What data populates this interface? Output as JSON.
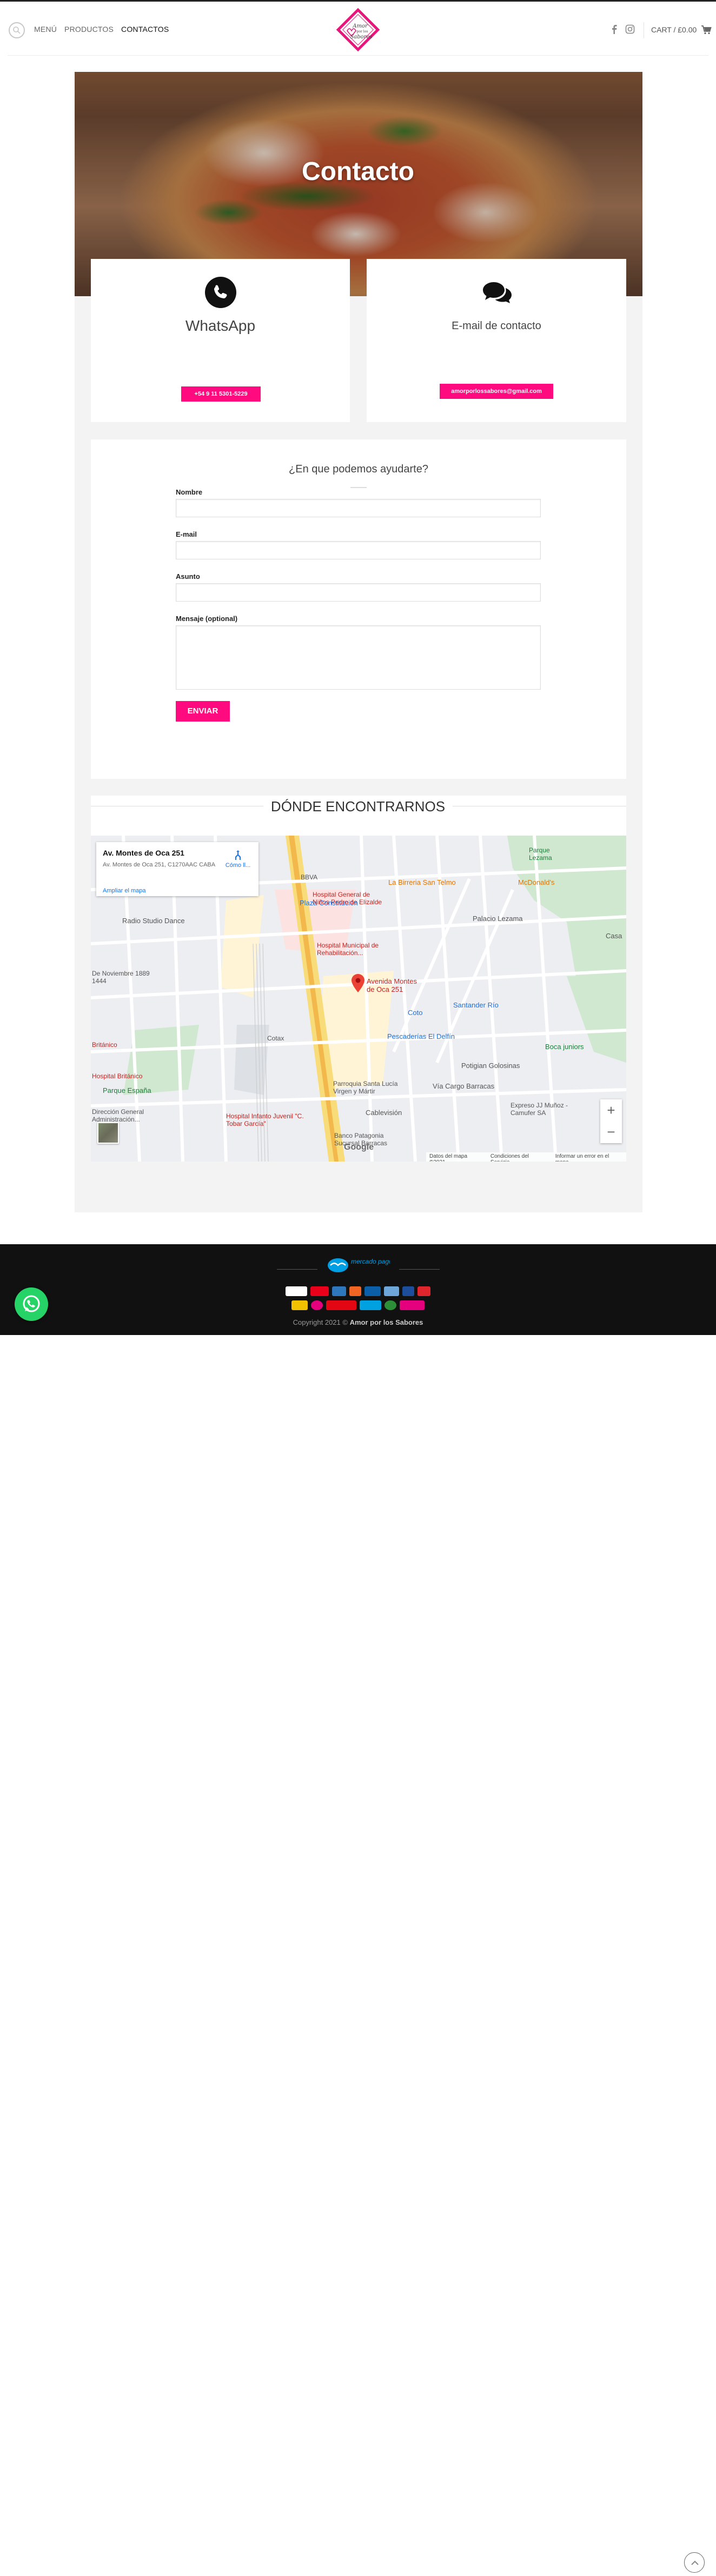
{
  "header": {
    "nav": [
      "MENÚ",
      "PRODUCTOS",
      "CONTACTOS"
    ],
    "active_nav": "CONTACTOS",
    "logo_text": "Amor por los Sabores",
    "cart_label": "CART / £0.00"
  },
  "hero": {
    "title": "Contacto"
  },
  "cards": {
    "whatsapp": {
      "title": "WhatsApp",
      "button": "+54 9 11 5301-5229"
    },
    "email": {
      "title": "E-mail de contacto",
      "button": "amorporlossabores@gmail.com"
    }
  },
  "form": {
    "title": "¿En que podemos ayudarte?",
    "labels": {
      "name": "Nombre",
      "email": "E-mail",
      "subject": "Asunto",
      "message": "Mensaje (optional)"
    },
    "submit": "ENVIAR"
  },
  "location": {
    "title": "DÓNDE ENCONTRARNOS",
    "info": {
      "title": "Av. Montes de Oca 251",
      "address": "Av. Montes de Oca 251, C1270AAC CABA",
      "link": "Ampliar el mapa",
      "directions": "Cómo ll..."
    },
    "pin_label": "Avenida Montes de Oca 251",
    "labels": [
      "BBVA",
      "Plaza Constitución",
      "Radio Studio Dance",
      "Hospital General de Niños Pedro de Elizalde",
      "Hospital Municipal de Rehabilitación...",
      "La Birreria San Telmo",
      "McDonald's",
      "Parque Lezama",
      "Palacio Lezama",
      "Casa",
      "De Noviembre 1889 1444",
      "Coto",
      "Santander Río",
      "Pescaderías El Delfín",
      "Cotax",
      "Boca juniors",
      "Potigian Golosinas",
      "Parroquia Santa Lucía Virgen y Mártir",
      "Vía Cargo Barracas",
      "Expreso JJ Muñoz - Camufer SA",
      "Cablevisión",
      "Hospital Británico",
      "Parque España",
      "Dirección General Administración...",
      "Hospital Infanto Juvenil \"C. Tobar García\"",
      "Banco Patagonia Sucursal Barracas",
      "Británico"
    ],
    "footer": [
      "Datos del mapa ©2021",
      "Condiciones del Servicio",
      "Informar un error en el mapa"
    ],
    "google": "Google",
    "zoom_in": "+",
    "zoom_out": "−"
  },
  "footer": {
    "mp_logo": "mercado pago",
    "copyright_prefix": "Copyright 2021 © ",
    "copyright_brand": "Amor por los Sabores",
    "payment_colors": [
      "#1a1f71",
      "#eb001b",
      "#2e77bc",
      "#f26522",
      "#0b5fa8",
      "#6fa6d9",
      "#1d4e9c",
      "#e0262d",
      "#f2c200",
      "#e5007d",
      "#e30613",
      "#00a1e0",
      "#2c8f37",
      "#e5007d"
    ]
  },
  "colors": {
    "accent": "#ff0a7f",
    "footer_bg": "#111111",
    "page_bg": "#f3f3f3"
  }
}
